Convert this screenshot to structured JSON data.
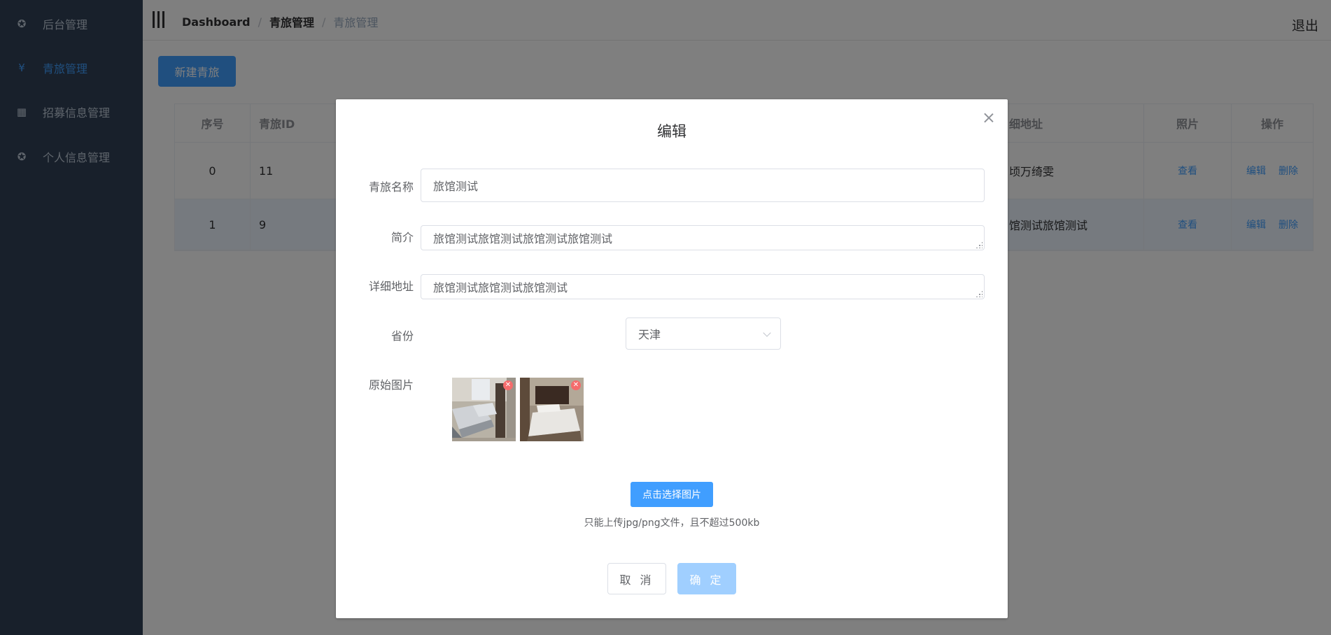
{
  "sidebar": {
    "items": [
      {
        "label": "后台管理",
        "icon": "gear-icon",
        "active": false
      },
      {
        "label": "青旅管理",
        "icon": "yen-icon",
        "active": true
      },
      {
        "label": "招募信息管理",
        "icon": "grid-icon",
        "active": false
      },
      {
        "label": "个人信息管理",
        "icon": "gear-icon",
        "active": false
      }
    ]
  },
  "header": {
    "breadcrumb": [
      "Dashboard",
      "青旅管理",
      "青旅管理"
    ],
    "separator": "/",
    "logout": "退出"
  },
  "main": {
    "new_button": "新建青旅",
    "table": {
      "headers": {
        "index": "序号",
        "id": "青旅ID",
        "address": "细地址",
        "photo": "照片",
        "actions": "操作"
      },
      "rows": [
        {
          "index": "0",
          "id": "11",
          "address": "顷万绮雯",
          "photo": "查看",
          "edit": "编辑",
          "delete": "删除"
        },
        {
          "index": "1",
          "id": "9",
          "address": "馆测试旅馆测试",
          "photo": "查看",
          "edit": "编辑",
          "delete": "删除"
        }
      ]
    }
  },
  "dialog": {
    "title": "编辑",
    "fields": {
      "name_label": "青旅名称",
      "name_value": "旅馆测试",
      "intro_label": "简介",
      "intro_value": "旅馆测试旅馆测试旅馆测试旅馆测试",
      "address_label": "详细地址",
      "address_value": "旅馆测试旅馆测试旅馆测试",
      "province_label": "省份",
      "province_value": "天津",
      "images_label": "原始图片"
    },
    "upload_button": "点击选择图片",
    "upload_tip": "只能上传jpg/png文件，且不超过500kb",
    "cancel": "取 消",
    "confirm": "确 定"
  },
  "colors": {
    "sidebar_bg": "#304156",
    "primary": "#409eff",
    "primary_disabled": "#a0cfff",
    "danger": "#f56c6c"
  }
}
